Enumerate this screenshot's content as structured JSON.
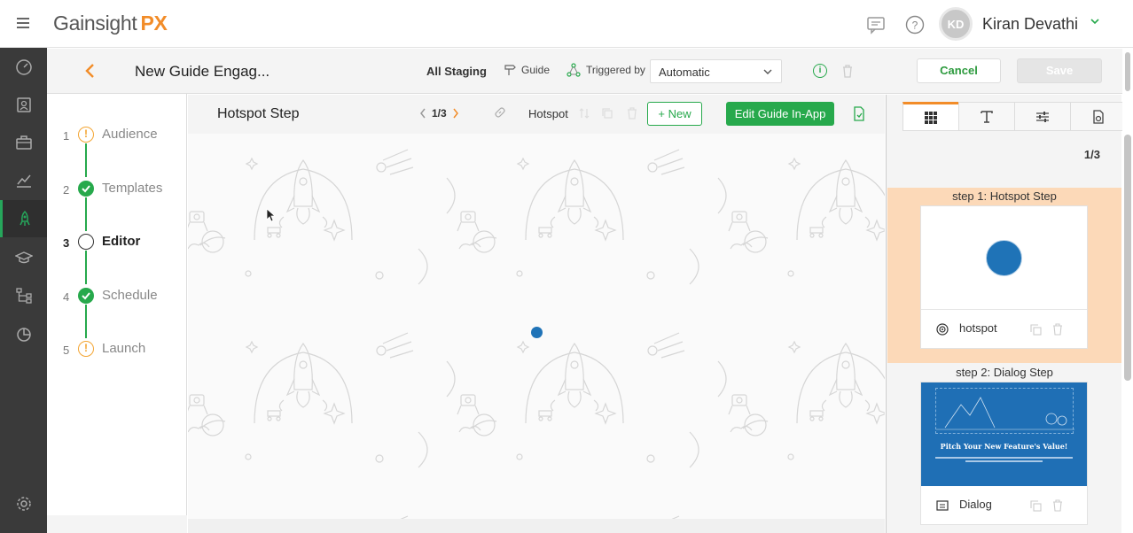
{
  "app": {
    "logo_main": "Gainsight",
    "logo_suffix": "PX",
    "user_initials": "KD",
    "user_name": "Kiran Devathi"
  },
  "subheader": {
    "guide_title": "New Guide Engag...",
    "environment": "All Staging",
    "guide_type": "Guide",
    "triggered_label": "Triggered by",
    "trigger_value": "Automatic",
    "info_label": "i",
    "cancel": "Cancel",
    "save": "Save"
  },
  "steps": [
    {
      "num": "1",
      "label": "Audience",
      "status": "warning"
    },
    {
      "num": "2",
      "label": "Templates",
      "status": "done"
    },
    {
      "num": "3",
      "label": "Editor",
      "status": "current"
    },
    {
      "num": "4",
      "label": "Schedule",
      "status": "done"
    },
    {
      "num": "5",
      "label": "Launch",
      "status": "warning"
    }
  ],
  "editor": {
    "step_name": "Hotspot Step",
    "pager": "1/3",
    "step_type": "Hotspot",
    "new_button": "+ New",
    "edit_in_app": "Edit Guide In-App"
  },
  "right_panel": {
    "count": "1/3",
    "tabs": [
      "grid-icon",
      "text-format-icon",
      "sliders-icon",
      "file-settings-icon"
    ],
    "cards": [
      {
        "title": "step 1: Hotspot Step",
        "label": "hotspot",
        "icon": "hotspot-icon",
        "selected": true
      },
      {
        "title": "step 2: Dialog Step",
        "label": "Dialog",
        "icon": "dialog-icon",
        "selected": false,
        "preview_title": "Pitch Your New Feature's Value!"
      }
    ]
  },
  "colors": {
    "accent_green": "#27a94c",
    "brand_orange": "#f28c28",
    "hotspot_blue": "#1f73b7",
    "nav_dark": "#3a3a3a"
  }
}
